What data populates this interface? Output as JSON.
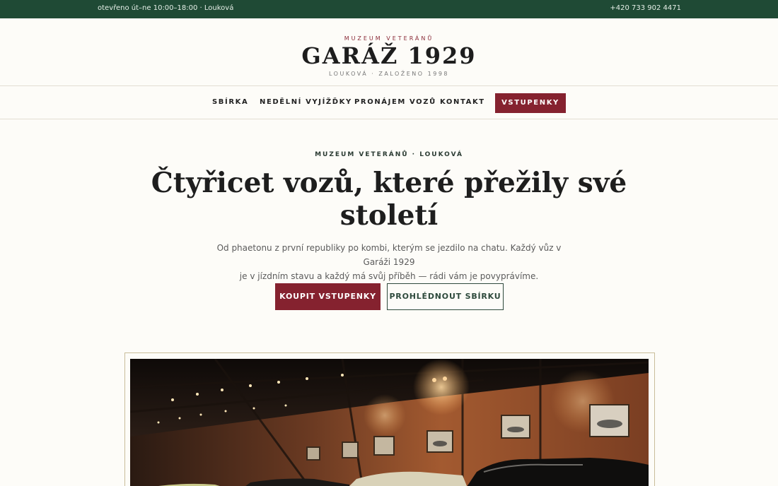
{
  "topbar": {
    "hours": "otevřeno út–ne 10:00–18:00 · Louková",
    "phone": "+420 733 902 4471"
  },
  "brand": {
    "eyebrow": "MUZEUM VETERÁNŮ",
    "logo": "GARÁŽ 1929",
    "tagline": "LOUKOVÁ · ZALOŽENO 1998"
  },
  "nav": {
    "items": [
      {
        "label": "SBÍRKA"
      },
      {
        "label": "NEDĚLNÍ VYJÍŽĎKY"
      },
      {
        "label": "PRONÁJEM VOZŮ"
      },
      {
        "label": "KONTAKT"
      }
    ],
    "cta": "VSTUPENKY"
  },
  "hero": {
    "eyebrow": "MUZEUM VETERÁNŮ · LOUKOVÁ",
    "title_line1": "Čtyřicet vozů, které přežily své",
    "title_line2": "století",
    "desc_line1": "Od phaetonu z první republiky po kombi, kterým se jezdilo na chatu. Každý vůz v Garáži 1929",
    "desc_line2": "je v jízdním stavu a každý má svůj příběh — rádi vám je povyprávíme.",
    "primary_button": "KOUPIT VSTUPENKY",
    "secondary_button": "PROHLÉDNOUT SBÍRKU"
  },
  "colors": {
    "topbar": "#1f4a35",
    "accent": "#85222f",
    "secondary_border": "#2e4a3c",
    "frame": "#c9bd9a",
    "background": "#fdfcf8"
  }
}
